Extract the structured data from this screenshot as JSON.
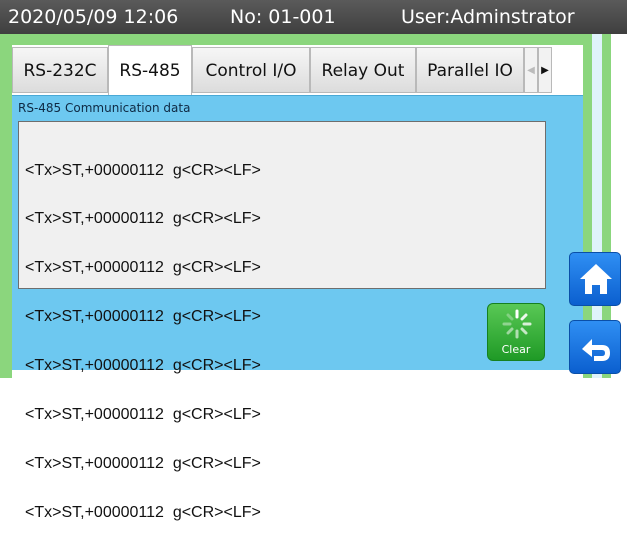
{
  "status": {
    "datetime": "2020/05/09 12:06",
    "number": "No: 01-001",
    "user": "User:Adminstrator"
  },
  "tabs": [
    {
      "label": "RS-232C",
      "active": false
    },
    {
      "label": "RS-485",
      "active": true
    },
    {
      "label": "Control I/O",
      "active": false
    },
    {
      "label": "Relay Out",
      "active": false
    },
    {
      "label": "Parallel IO",
      "active": false
    }
  ],
  "tab_scroll": {
    "left_icon": "chevron-left-icon",
    "right_icon": "chevron-right-icon"
  },
  "panel": {
    "title": "RS-485 Communication data",
    "lines": [
      "<Tx>ST,+00000112  g<CR><LF>",
      "<Tx>ST,+00000112  g<CR><LF>",
      "<Tx>ST,+00000112  g<CR><LF>",
      "<Tx>ST,+00000112  g<CR><LF>",
      "<Tx>ST,+00000112  g<CR><LF>",
      "<Tx>ST,+00000112  g<CR><LF>",
      "<Tx>ST,+00000112  g<CR><LF>",
      "<Tx>ST,+00000112  g<CR><LF>"
    ]
  },
  "buttons": {
    "clear_label": "Clear",
    "clear_icon": "spinner-icon",
    "home_icon": "home-icon",
    "back_icon": "return-arrow-icon"
  },
  "colors": {
    "status_bar": "#4a4a4a",
    "frame_green": "#8bd67d",
    "panel_blue": "#6dc8f0",
    "side_button_blue": "#1a74e0",
    "clear_green": "#2fae35"
  }
}
